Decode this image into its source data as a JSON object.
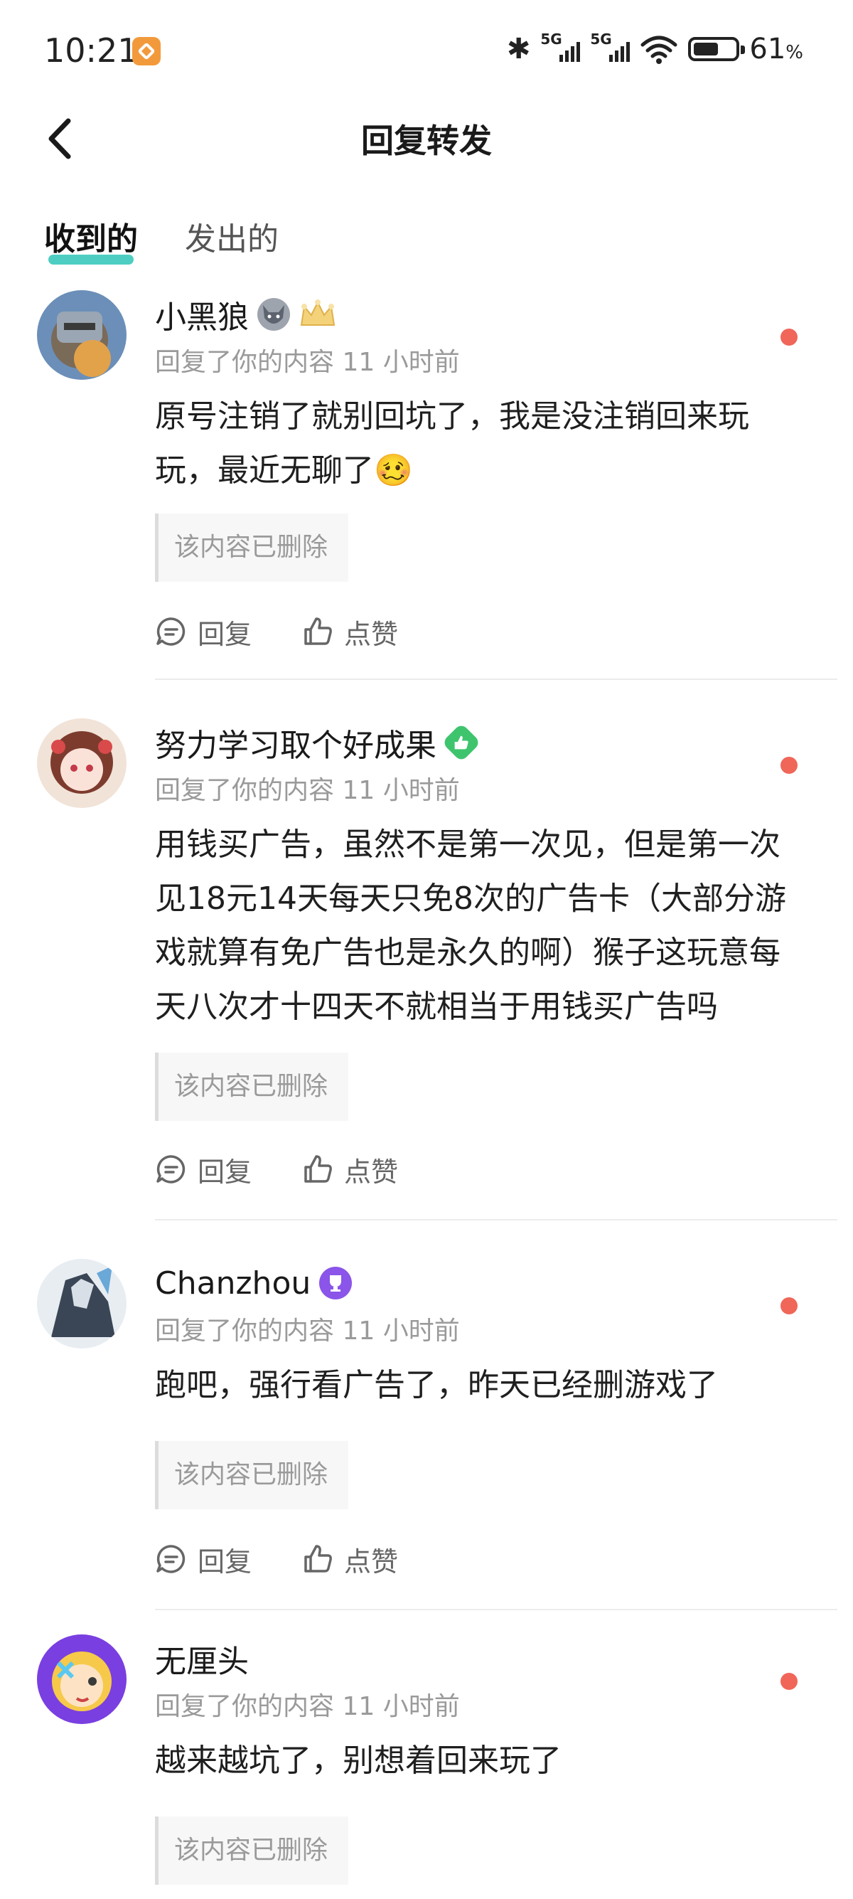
{
  "status_bar": {
    "time": "10:21",
    "signal_labels": [
      "5G",
      "5G"
    ],
    "battery_percent": "61",
    "battery_unit": "%",
    "battery_level": 0.61
  },
  "nav": {
    "title": "回复转发",
    "back_icon": "chevron-left-icon"
  },
  "tabs": [
    {
      "label": "收到的",
      "active": true
    },
    {
      "label": "发出的",
      "active": false
    }
  ],
  "actions": {
    "reply_label": "回复",
    "like_label": "点赞"
  },
  "items": [
    {
      "username": "小黑狼",
      "badges": [
        "wolf-emoji-icon",
        "crown-icon"
      ],
      "meta": "回复了你的内容 11 小时前",
      "content": "原号注销了就别回坑了，我是没注销回来玩玩，最近无聊了",
      "content_emoji": "🥴",
      "quote": "该内容已删除",
      "unread": true
    },
    {
      "username": "努力学习取个好成果",
      "badges": [
        "thumbs-up-badge-icon"
      ],
      "meta": "回复了你的内容 11 小时前",
      "content": "用钱买广告，虽然不是第一次见，但是第一次见18元14天每天只免8次的广告卡（大部分游戏就算有免广告也是永久的啊）猴子这玩意每天八次才十四天不就相当于用钱买广告吗",
      "quote": "该内容已删除",
      "unread": true
    },
    {
      "username": "Chanzhou",
      "badges": [
        "trophy-badge-icon"
      ],
      "meta": "回复了你的内容 11 小时前",
      "content": "跑吧，强行看广告了，昨天已经删游戏了",
      "quote": "该内容已删除",
      "unread": true
    },
    {
      "username": "无厘头",
      "badges": [],
      "meta": "回复了你的内容 11 小时前",
      "content": "越来越坑了，别想着回来玩了",
      "quote": "该内容已删除",
      "unread": true
    }
  ],
  "colors": {
    "tab_underline": "#2fc6b8",
    "unread_dot": "#f06659",
    "badge_green": "#3fc46e",
    "badge_purple": "#8a55e8"
  }
}
